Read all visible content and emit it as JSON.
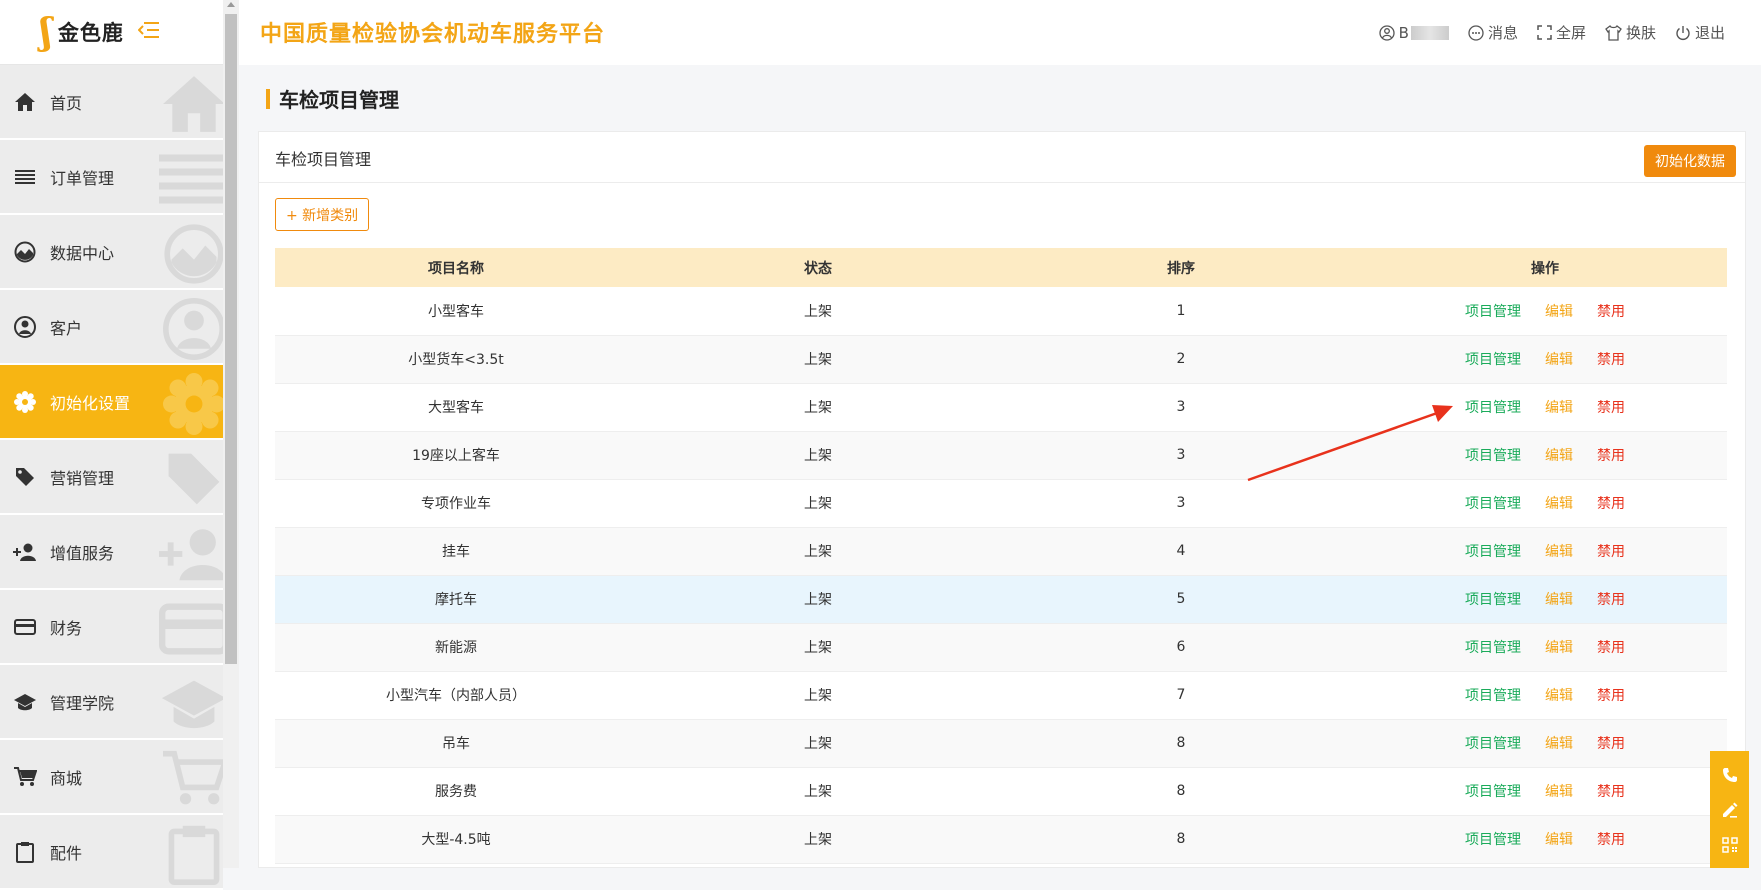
{
  "brand": {
    "logo_text": "金色鹿"
  },
  "header": {
    "title": "中国质量检验协会机动车服务平台",
    "user_name": "B",
    "message": "消息",
    "fullscreen": "全屏",
    "skin": "换肤",
    "logout": "退出"
  },
  "sidebar": {
    "items": [
      {
        "label": "首页",
        "icon": "home-icon"
      },
      {
        "label": "订单管理",
        "icon": "list-icon"
      },
      {
        "label": "数据中心",
        "icon": "chart-circle-icon"
      },
      {
        "label": "客户",
        "icon": "user-icon"
      },
      {
        "label": "初始化设置",
        "icon": "gear-icon",
        "active": true
      },
      {
        "label": "营销管理",
        "icon": "tag-icon"
      },
      {
        "label": "增值服务",
        "icon": "add-user-icon"
      },
      {
        "label": "财务",
        "icon": "card-icon"
      },
      {
        "label": "管理学院",
        "icon": "graduation-cap-icon"
      },
      {
        "label": "商城",
        "icon": "cart-icon"
      },
      {
        "label": "配件",
        "icon": "clipboard-icon"
      }
    ]
  },
  "page": {
    "heading": "车检项目管理",
    "card_title": "车检项目管理",
    "init_button": "初始化数据",
    "add_button": "+ 新增类别"
  },
  "table": {
    "headers": [
      "项目名称",
      "状态",
      "排序",
      "操作"
    ],
    "actions": {
      "manage": "项目管理",
      "edit": "编辑",
      "disable": "禁用"
    },
    "rows": [
      {
        "name": "小型客车",
        "status": "上架",
        "order": "1"
      },
      {
        "name": "小型货车<3.5t",
        "status": "上架",
        "order": "2"
      },
      {
        "name": "大型客车",
        "status": "上架",
        "order": "3"
      },
      {
        "name": "19座以上客车",
        "status": "上架",
        "order": "3"
      },
      {
        "name": "专项作业车",
        "status": "上架",
        "order": "3"
      },
      {
        "name": "挂车",
        "status": "上架",
        "order": "4"
      },
      {
        "name": "摩托车",
        "status": "上架",
        "order": "5"
      },
      {
        "name": "新能源",
        "status": "上架",
        "order": "6"
      },
      {
        "name": "小型汽车（内部人员）",
        "status": "上架",
        "order": "7"
      },
      {
        "name": "吊车",
        "status": "上架",
        "order": "8"
      },
      {
        "name": "服务费",
        "status": "上架",
        "order": "8"
      },
      {
        "name": "大型-4.5吨",
        "status": "上架",
        "order": "8"
      }
    ]
  },
  "colors": {
    "accent": "#f7b513",
    "brand_orange": "#f08a0d",
    "manage": "#1aab5a",
    "edit": "#f3a516",
    "disable": "#e8321c"
  },
  "float_tools": [
    "phone-icon",
    "edit-icon",
    "qrcode-icon"
  ]
}
